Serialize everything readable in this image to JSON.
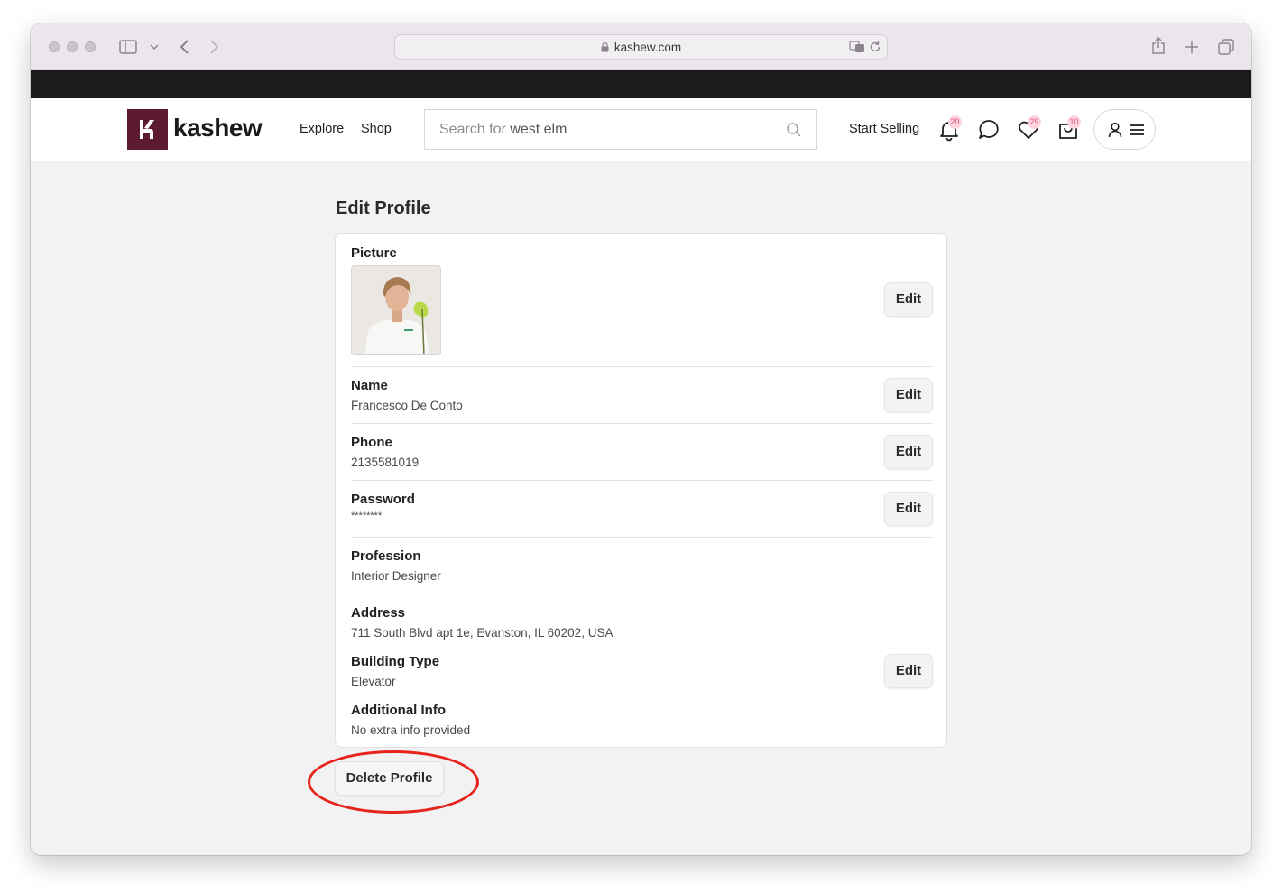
{
  "browser": {
    "url": "kashew.com"
  },
  "header": {
    "logo_text": "kashew",
    "nav": [
      "Explore",
      "Shop"
    ],
    "search_placeholder_prefix": "Search for",
    "search_placeholder_term": "west elm",
    "start_selling": "Start Selling",
    "notifications_count": "20",
    "favorites_count": "29",
    "cart_count": "10"
  },
  "page": {
    "title": "Edit Profile",
    "picture_label": "Picture",
    "edit_label": "Edit",
    "fields": {
      "name": {
        "label": "Name",
        "value": "Francesco De Conto"
      },
      "phone": {
        "label": "Phone",
        "value": "2135581019"
      },
      "password": {
        "label": "Password",
        "value": "********"
      },
      "profession": {
        "label": "Profession",
        "value": "Interior Designer"
      },
      "address": {
        "label": "Address",
        "value": "711 South Blvd apt 1e, Evanston, IL 60202, USA"
      },
      "building_type": {
        "label": "Building Type",
        "value": "Elevator"
      },
      "additional_info": {
        "label": "Additional Info",
        "value": "No extra info provided"
      }
    },
    "delete_label": "Delete Profile"
  },
  "colors": {
    "brand": "#5b1a31",
    "badge_bg": "#ffd4de",
    "badge_text": "#e0507a",
    "annotation_circle": "#e5231b"
  }
}
